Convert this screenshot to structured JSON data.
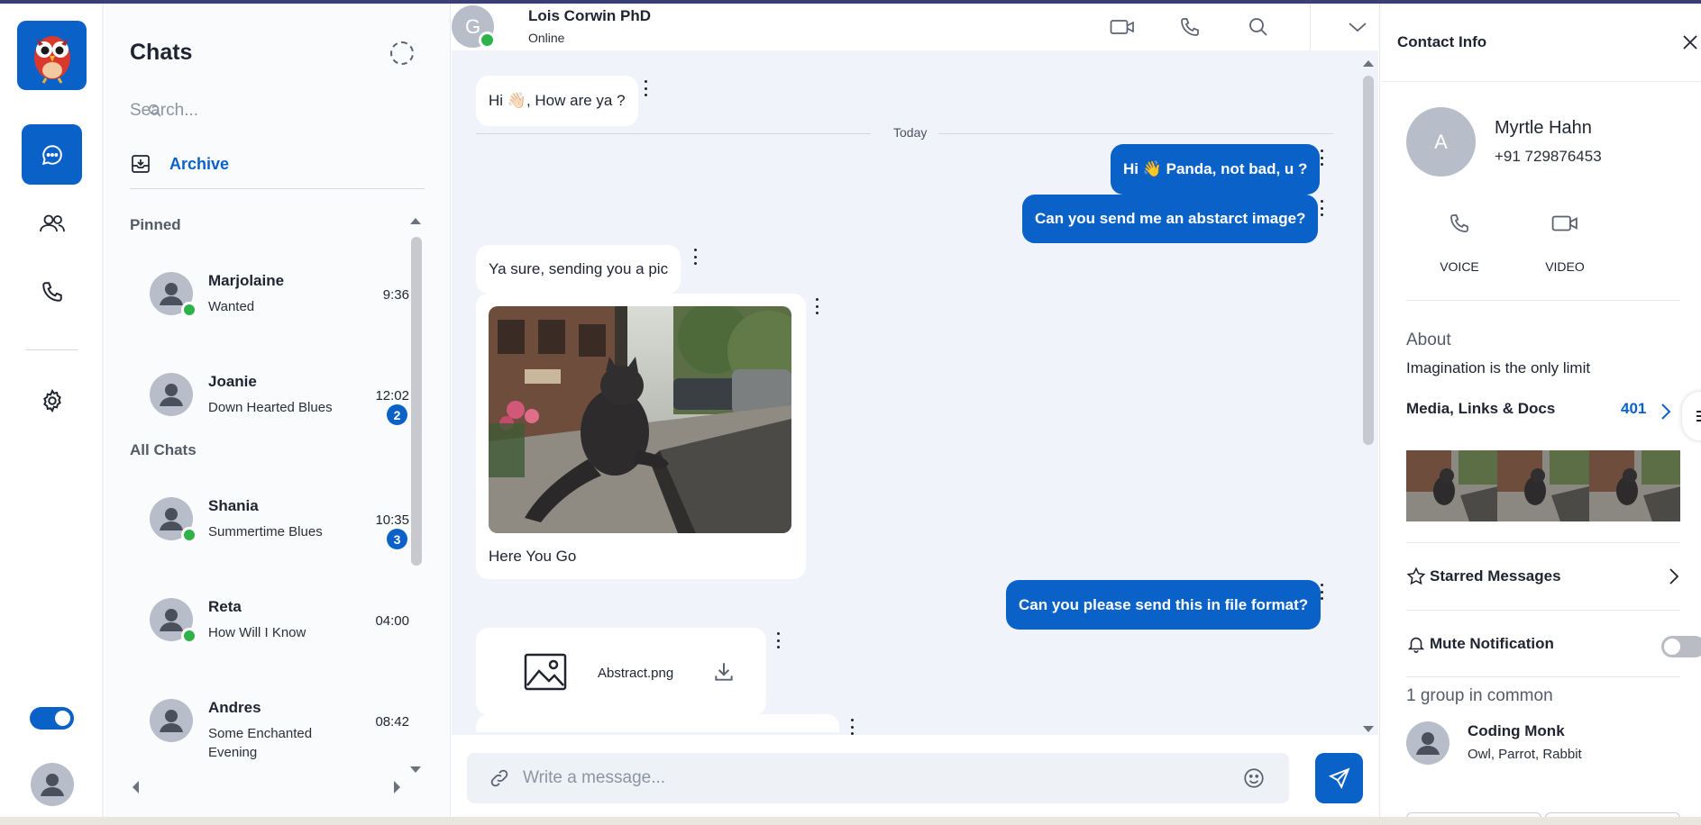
{
  "nav": {
    "items": [
      "chats",
      "contacts",
      "calls",
      "settings"
    ]
  },
  "chats": {
    "title": "Chats",
    "search_placeholder": "Search...",
    "archive_label": "Archive",
    "pinned_label": "Pinned",
    "all_label": "All Chats",
    "pinned": [
      {
        "name": "Marjolaine",
        "message": "Wanted",
        "time": "9:36",
        "online": true,
        "unread": ""
      },
      {
        "name": "Joanie",
        "message": "Down Hearted Blues",
        "time": "12:02",
        "online": false,
        "unread": "2"
      }
    ],
    "all": [
      {
        "name": "Shania",
        "message": "Summertime Blues",
        "time": "10:35",
        "online": true,
        "unread": "3"
      },
      {
        "name": "Reta",
        "message": "How Will I Know",
        "time": "04:00",
        "online": true,
        "unread": ""
      },
      {
        "name": "Andres",
        "message": "Some Enchanted Evening",
        "time": "08:42",
        "online": false,
        "unread": ""
      }
    ]
  },
  "conversation": {
    "avatar_letter": "G",
    "name": "Lois Corwin PhD",
    "status": "Online",
    "divider": "Today",
    "messages": [
      {
        "dir": "in",
        "text": "Hi 👋🏻, How are ya ?"
      },
      {
        "dir": "out",
        "text": "Hi 👋 Panda, not bad, u ?"
      },
      {
        "dir": "out",
        "text": "Can you send me an abstarct image?"
      },
      {
        "dir": "in",
        "text": "Ya sure, sending you a pic"
      },
      {
        "dir": "in",
        "text": "Here You Go",
        "image": "cat-statue-photo"
      },
      {
        "dir": "out",
        "text": "Can you please send this in file format?"
      },
      {
        "dir": "in",
        "file": "Abstract.png"
      }
    ],
    "composer_placeholder": "Write a message..."
  },
  "contact": {
    "title": "Contact Info",
    "avatar_letter": "A",
    "name": "Myrtle Hahn",
    "phone": "+91 729876453",
    "voice_label": "VOICE",
    "video_label": "VIDEO",
    "about_label": "About",
    "about_text": "Imagination is the only limit",
    "media_label": "Media, Links & Docs",
    "media_count": "401",
    "starred_label": "Starred Messages",
    "mute_label": "Mute Notification",
    "mute_on": false,
    "groups_label": "1 group in common",
    "group": {
      "name": "Coding Monk",
      "members": "Owl, Parrot, Rabbit"
    }
  },
  "colors": {
    "accent": "#0a62c9",
    "online": "#2db34a",
    "background": "#f0f4fa"
  }
}
